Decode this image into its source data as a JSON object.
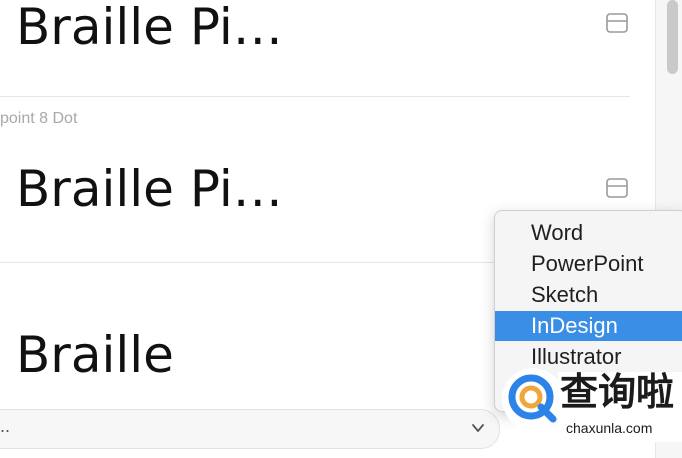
{
  "fonts": {
    "items": [
      {
        "preview": "Braille Pi…",
        "name": ""
      },
      {
        "preview": "Braille Pi…",
        "name": "point 8 Dot"
      },
      {
        "preview": "Braille",
        "name": ""
      }
    ]
  },
  "bottom_bar": {
    "value": ".."
  },
  "menu": {
    "items": [
      {
        "label": "Word"
      },
      {
        "label": "PowerPoint"
      },
      {
        "label": "Sketch"
      },
      {
        "label": "InDesign",
        "selected": true
      },
      {
        "label": "Illustrator"
      }
    ],
    "selected_color": "#3a8ee6"
  },
  "watermark": {
    "title": "查询啦",
    "url": "chaxunla.com",
    "ring_color": "#2e83e8",
    "q_color": "#f0a63a"
  },
  "icons": {
    "card_icon": "archive-box-icon",
    "dropdown_chevron": "chevron-down-icon"
  }
}
